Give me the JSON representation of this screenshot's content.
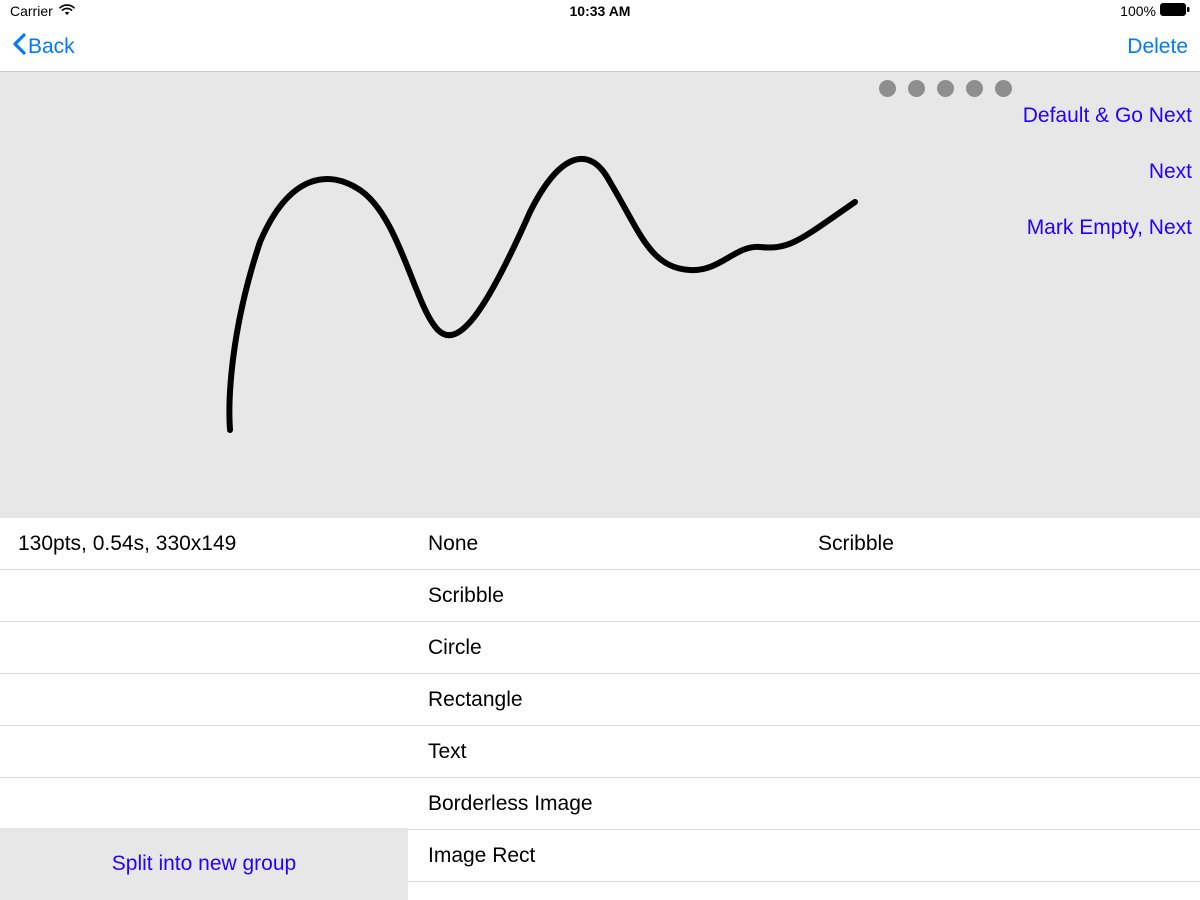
{
  "status_bar": {
    "carrier": "Carrier",
    "time": "10:33 AM",
    "battery_pct": "100%"
  },
  "nav": {
    "back": "Back",
    "delete": "Delete"
  },
  "canvas": {
    "dot_count": 5,
    "actions": {
      "default_next": "Default & Go Next",
      "next": "Next",
      "mark_empty_next": "Mark Empty, Next"
    }
  },
  "info": {
    "stats": "130pts, 0.54s, 330x149",
    "split_button": "Split into new group"
  },
  "type_options": [
    "None",
    "Scribble",
    "Circle",
    "Rectangle",
    "Text",
    "Borderless Image",
    "Image Rect"
  ],
  "selection": {
    "current": "Scribble"
  },
  "colors": {
    "ios_blue": "#007aff",
    "action_blue": "#2600ff",
    "canvas_bg": "#e7e7e7"
  }
}
